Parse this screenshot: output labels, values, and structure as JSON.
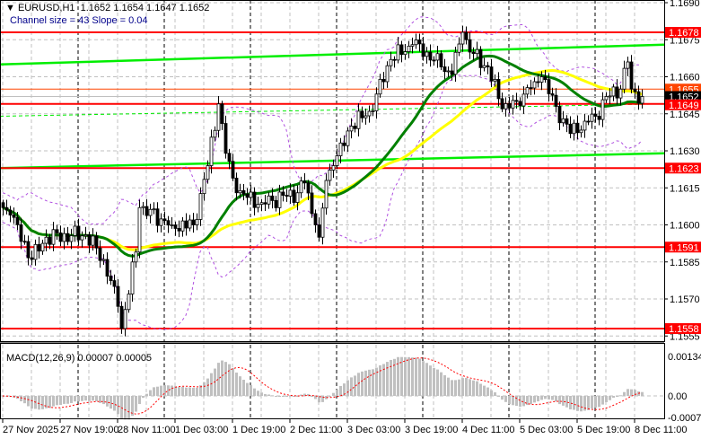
{
  "header": {
    "symbol_line": "EURUSD,H1  1.1652 1.1654 1.1647 1.1652",
    "channel_line": "Channel size = 43 Slope = 0.04"
  },
  "macd_label": "MACD(12,26,9) 0.00007 0.00005",
  "chart_data": {
    "type": "candlestick",
    "title": "EURUSD,H1",
    "ohlc_last": {
      "open": 1.1652,
      "high": 1.1654,
      "low": 1.1647,
      "close": 1.1652
    },
    "bars": 179,
    "close_path": [
      [
        0,
        1.1607
      ],
      [
        2,
        1.1604
      ],
      [
        8,
        1.1586
      ],
      [
        12,
        1.1595
      ],
      [
        23,
        1.1596
      ],
      [
        28,
        1.1586
      ],
      [
        32,
        1.1567
      ],
      [
        33,
        1.1558
      ],
      [
        37,
        1.1589
      ],
      [
        38,
        1.1607
      ],
      [
        47,
        1.16
      ],
      [
        53,
        1.16
      ],
      [
        57,
        1.1624
      ],
      [
        60,
        1.1649
      ],
      [
        62,
        1.1629
      ],
      [
        65,
        1.1613
      ],
      [
        72,
        1.1609
      ],
      [
        82,
        1.1613
      ],
      [
        84,
        1.1617
      ],
      [
        87,
        1.16
      ],
      [
        88,
        1.1595
      ],
      [
        90,
        1.1618
      ],
      [
        92,
        1.1624
      ],
      [
        97,
        1.164
      ],
      [
        102,
        1.1646
      ],
      [
        104,
        1.1653
      ],
      [
        108,
        1.1667
      ],
      [
        114,
        1.1673
      ],
      [
        118,
        1.167
      ],
      [
        122,
        1.1664
      ],
      [
        125,
        1.1661
      ],
      [
        128,
        1.1678
      ],
      [
        130,
        1.167
      ],
      [
        135,
        1.1664
      ],
      [
        139,
        1.1647
      ],
      [
        143,
        1.165
      ],
      [
        148,
        1.1658
      ],
      [
        150,
        1.166
      ],
      [
        154,
        1.1648
      ],
      [
        158,
        1.1637
      ],
      [
        162,
        1.1642
      ],
      [
        165,
        1.1644
      ],
      [
        168,
        1.1652
      ],
      [
        172,
        1.1655
      ],
      [
        174,
        1.1666
      ],
      [
        175,
        1.1655
      ],
      [
        178,
        1.1652
      ]
    ],
    "ylim": [
      1.1552,
      1.1691
    ],
    "price_axis": {
      "ticks": [
        "1.1690",
        "1.1675",
        "1.1660",
        "1.1645",
        "1.1630",
        "1.1615",
        "1.1600",
        "1.1585",
        "1.1570",
        "1.1555"
      ],
      "values": [
        1.169,
        1.1675,
        1.166,
        1.1645,
        1.163,
        1.1615,
        1.16,
        1.1585,
        1.157,
        1.1555
      ]
    },
    "levels": [
      {
        "label": "1.1678",
        "value": 1.1678,
        "color": "#ff0000"
      },
      {
        "label": "1.1655",
        "value": 1.1655,
        "color": "#ff4500"
      },
      {
        "label": "1.1649",
        "value": 1.1649,
        "color": "#ff0000"
      },
      {
        "label": "1.1623",
        "value": 1.1623,
        "color": "#ff0000"
      },
      {
        "label": "1.1591",
        "value": 1.1591,
        "color": "#ff0000"
      },
      {
        "label": "1.1558",
        "value": 1.1558,
        "color": "#ff0000"
      }
    ],
    "current_price": {
      "label": "1.1652",
      "value": 1.1652
    },
    "channel": {
      "upper": [
        1.1665,
        1.1673
      ],
      "middle": [
        1.1644,
        1.1649
      ],
      "lower": [
        1.1623,
        1.1629
      ],
      "color": "#00ee00"
    },
    "moving_averages": [
      {
        "period": 30,
        "color": "#008000"
      },
      {
        "period": 50,
        "color": "#ffff00"
      }
    ],
    "bollinger": {
      "period": 20,
      "deviation": 2,
      "color": "#b050e0"
    },
    "time_axis": {
      "labels": [
        "27 Nov 2025",
        "27 Nov 19:00",
        "28 Nov 11:00",
        "1 Dec 03:00",
        "1 Dec 19:00",
        "2 Dec 11:00",
        "3 Dec 03:00",
        "3 Dec 19:00",
        "4 Dec 11:00",
        "5 Dec 03:00",
        "5 Dec 19:00",
        "8 Dec 11:00"
      ],
      "bar_index": [
        0,
        16,
        32,
        48,
        64,
        80,
        96,
        112,
        128,
        144,
        160,
        176
      ]
    },
    "macd": {
      "params": [
        12,
        26,
        9
      ],
      "value": 7e-05,
      "signal": 5e-05,
      "axis_ticks": [
        "0.00134",
        "0.00",
        "-0.00073"
      ],
      "axis_values": [
        0.00134,
        0.0,
        -0.00073
      ],
      "hist_color": "#c0c0c0",
      "signal_color": "#ff0000"
    }
  }
}
